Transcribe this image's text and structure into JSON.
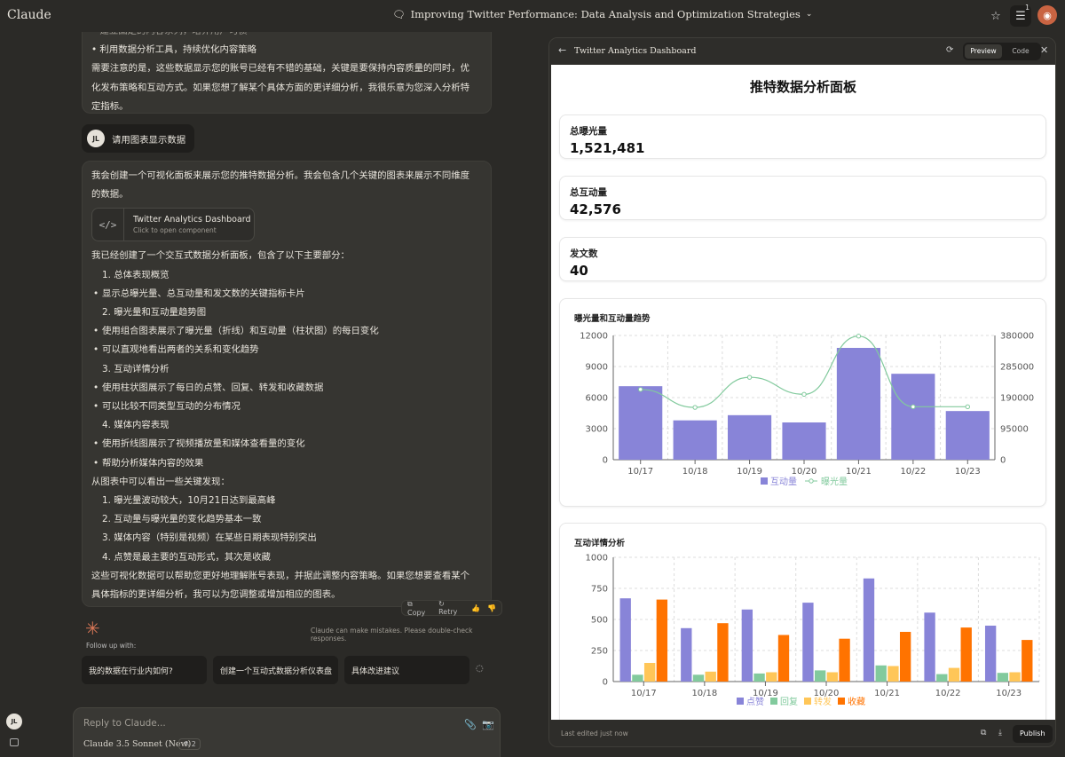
{
  "app": {
    "logo": "Claude"
  },
  "conversation": {
    "title": "Improving Twitter Performance: Data Analysis and Optimization Strategies",
    "star_badge": "1"
  },
  "chat": {
    "top_lines": [
      "• 建立固定的内容系列，培养用户习惯",
      "• 利用数据分析工具，持续优化内容策略"
    ],
    "top_para": [
      "需要注意的是，这些数据显示您的账号已经有不错的基础，关键是要保持内容质量的同时，优",
      "化发布策略和互动方式。如果您想了解某个具体方面的更详细分析，我很乐意为您深入分析特",
      "定指标。"
    ],
    "user_initials": "JL",
    "user_message": "请用图表显示数据",
    "intro": [
      "我会创建一个可视化面板来展示您的推特数据分析。我会包含几个关键的图表来展示不同维度",
      "的数据。"
    ],
    "artifact": {
      "title": "Twitter Analytics Dashboard",
      "subtitle": "Click to open component",
      "icon": "</>"
    },
    "built": "我已经创建了一个交互式数据分析面板，包含了以下主要部分：",
    "items": [
      {
        "t": "1. 总体表现概览",
        "b": false
      },
      {
        "t": "显示总曝光量、总互动量和发文数的关键指标卡片",
        "b": true
      },
      {
        "t": "2. 曝光量和互动量趋势图",
        "b": false
      },
      {
        "t": "使用组合图表展示了曝光量（折线）和互动量（柱状图）的每日变化",
        "b": true
      },
      {
        "t": "可以直观地看出两者的关系和变化趋势",
        "b": true
      },
      {
        "t": "3. 互动详情分析",
        "b": false
      },
      {
        "t": "使用柱状图展示了每日的点赞、回复、转发和收藏数据",
        "b": true
      },
      {
        "t": "可以比较不同类型互动的分布情况",
        "b": true
      },
      {
        "t": "4. 媒体内容表现",
        "b": false
      },
      {
        "t": "使用折线图展示了视频播放量和媒体查看量的变化",
        "b": true
      },
      {
        "t": "帮助分析媒体内容的效果",
        "b": true
      }
    ],
    "findings_intro": "从图表中可以看出一些关键发现：",
    "findings": [
      "1. 曝光量波动较大，10月21日达到最高峰",
      "2. 互动量与曝光量的变化趋势基本一致",
      "3. 媒体内容（特别是视频）在某些日期表现特别突出",
      "4. 点赞是最主要的互动形式，其次是收藏"
    ],
    "outro": [
      "这些可视化数据可以帮助您更好地理解账号表现，并据此调整内容策略。如果您想要查看某个",
      "具体指标的更详细分析，我可以为您调整或增加相应的图表。"
    ],
    "actions": {
      "copy": "Copy",
      "retry": "Retry"
    },
    "disclaimer": "Claude can make mistakes. Please double-check responses.",
    "followup_label": "Follow up with:",
    "followups": [
      "我的数据在行业内如何?",
      "创建一个互动式数据分析仪表盘",
      "具体改进建议"
    ],
    "reply_placeholder": "Reply to Claude...",
    "model": "Claude 3.5 Sonnet (New)",
    "model_badge": "⚗ 2"
  },
  "panel": {
    "title": "Twitter Analytics Dashboard",
    "tab_preview": "Preview",
    "tab_code": "Code",
    "last_edited": "Last edited just now",
    "publish": "Publish"
  },
  "dashboard": {
    "title": "推特数据分析面板",
    "metrics": [
      {
        "label": "总曝光量",
        "value": "1,521,481"
      },
      {
        "label": "总互动量",
        "value": "42,576"
      },
      {
        "label": "发文数",
        "value": "40"
      }
    ]
  },
  "colors": {
    "bar": "#8884d8",
    "line": "#82ca9d",
    "retweet": "#ffc658",
    "bookmark": "#ff7300"
  },
  "chart_data": [
    {
      "type": "bar",
      "title": "曝光量和互动量趋势",
      "categories": [
        "10/17",
        "10/18",
        "10/19",
        "10/20",
        "10/21",
        "10/22",
        "10/23"
      ],
      "series": [
        {
          "name": "互动量",
          "values": [
            7100,
            3800,
            4300,
            3600,
            10800,
            8300,
            4700
          ],
          "axis": "left",
          "kind": "bar"
        },
        {
          "name": "曝光量",
          "values": [
            215000,
            160000,
            252000,
            200000,
            378000,
            162000,
            162000
          ],
          "axis": "right",
          "kind": "line"
        }
      ],
      "ylim": [
        0,
        12000
      ],
      "yticks": [
        "12000",
        "9000",
        "6000",
        "3000",
        "0"
      ],
      "y2lim": [
        0,
        380000
      ],
      "y2ticks": [
        "380000",
        "285000",
        "190000",
        "95000",
        "0"
      ],
      "legend": "bottom",
      "grid": true
    },
    {
      "type": "bar",
      "title": "互动详情分析",
      "categories": [
        "10/17",
        "10/18",
        "10/19",
        "10/20",
        "10/21",
        "10/22",
        "10/23"
      ],
      "series": [
        {
          "name": "点赞",
          "values": [
            670,
            430,
            580,
            635,
            830,
            555,
            450
          ]
        },
        {
          "name": "回复",
          "values": [
            55,
            55,
            65,
            90,
            130,
            60,
            70
          ]
        },
        {
          "name": "转发",
          "values": [
            150,
            80,
            75,
            75,
            125,
            110,
            75
          ]
        },
        {
          "name": "收藏",
          "values": [
            660,
            470,
            375,
            345,
            400,
            435,
            335
          ]
        }
      ],
      "ylim": [
        0,
        1000
      ],
      "yticks": [
        "1000",
        "750",
        "500",
        "250",
        "0"
      ],
      "legend": "bottom",
      "grid": true
    }
  ]
}
